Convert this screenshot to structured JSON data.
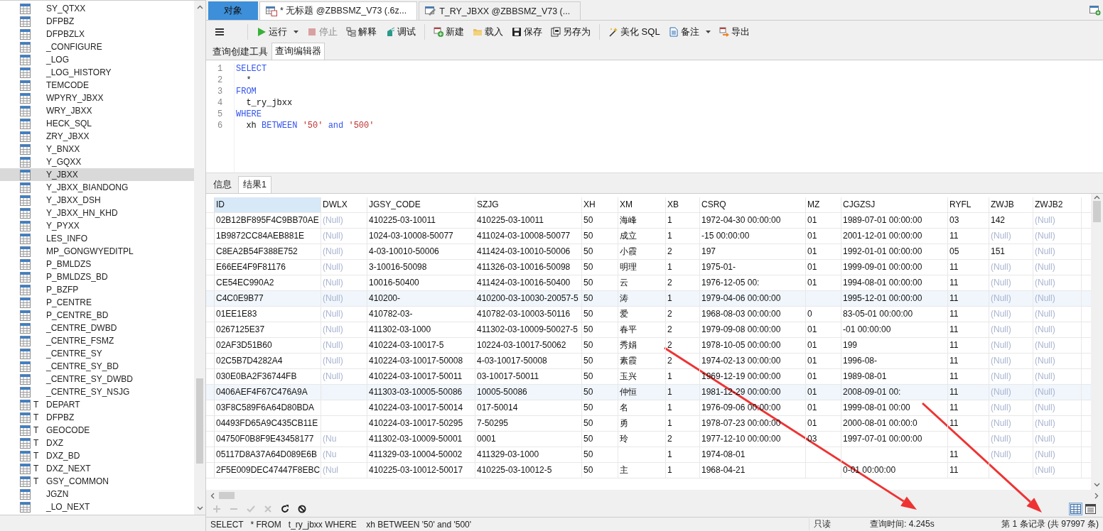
{
  "object_tree": {
    "items": [
      {
        "label": "SY_QTXX",
        "selected": false
      },
      {
        "label": "DFPBZ",
        "selected": false
      },
      {
        "label": "DFPBZLX",
        "selected": false
      },
      {
        "label": "_CONFIGURE",
        "selected": false
      },
      {
        "label": "_LOG",
        "selected": false
      },
      {
        "label": "_LOG_HISTORY",
        "selected": false
      },
      {
        "label": "TEMCODE",
        "selected": false
      },
      {
        "label": "WPYRY_JBXX",
        "selected": false
      },
      {
        "label": "WRY_JBXX",
        "selected": false
      },
      {
        "label": "HECK_SQL",
        "selected": false
      },
      {
        "label": "ZRY_JBXX",
        "selected": false
      },
      {
        "label": "Y_BNXX",
        "selected": false
      },
      {
        "label": "Y_GQXX",
        "selected": false
      },
      {
        "label": "Y_JBXX",
        "selected": true
      },
      {
        "label": "Y_JBXX_BIANDONG",
        "selected": false
      },
      {
        "label": "Y_JBXX_DSH",
        "selected": false
      },
      {
        "label": "Y_JBXX_HN_KHD",
        "selected": false
      },
      {
        "label": "Y_PYXX",
        "selected": false
      },
      {
        "label": "LES_INFO",
        "selected": false
      },
      {
        "label": "MP_GONGWYEDITPL",
        "selected": false
      },
      {
        "label": "P_BMLDZS",
        "selected": false
      },
      {
        "label": "P_BMLDZS_BD",
        "selected": false
      },
      {
        "label": "P_BZFP",
        "selected": false
      },
      {
        "label": "P_CENTRE",
        "selected": false
      },
      {
        "label": "P_CENTRE_BD",
        "selected": false
      },
      {
        "label": "_CENTRE_DWBD",
        "selected": false
      },
      {
        "label": "_CENTRE_FSMZ",
        "selected": false
      },
      {
        "label": "_CENTRE_SY",
        "selected": false
      },
      {
        "label": "_CENTRE_SY_BD",
        "selected": false
      },
      {
        "label": "_CENTRE_SY_DWBD",
        "selected": false
      },
      {
        "label": "_CENTRE_SY_NSJG",
        "selected": false
      },
      {
        "lead": "T",
        "label": "DEPART",
        "selected": false
      },
      {
        "lead": "T",
        "label": "DFPBZ",
        "selected": false
      },
      {
        "lead": "T",
        "label": "GEOCODE",
        "selected": false
      },
      {
        "lead": "T",
        "label": "DXZ",
        "selected": false
      },
      {
        "lead": "T",
        "label": "DXZ_BD",
        "selected": false
      },
      {
        "lead": "T",
        "label": "DXZ_NEXT",
        "selected": false
      },
      {
        "lead": "T",
        "label": "GSY_COMMON",
        "selected": false
      },
      {
        "label": "JGZN",
        "selected": false
      },
      {
        "label": "_LO_NEXT",
        "selected": false
      }
    ]
  },
  "editor_tabs": [
    {
      "kind": "objects",
      "label": "对象",
      "selected": false
    },
    {
      "kind": "query",
      "label": "* 无标题 @ZBBSMZ_V73 (.6z...",
      "selected": true
    },
    {
      "kind": "design",
      "label": "T_RY_JBXX @ZBBSMZ_V73 (...",
      "selected": false
    }
  ],
  "toolbar": [
    [
      {
        "kind": "menu"
      }
    ],
    [
      {
        "kind": "run",
        "label": "运行",
        "dropdown": true,
        "disabled": false
      },
      {
        "kind": "stop",
        "label": "停止",
        "disabled": true
      },
      {
        "kind": "explain",
        "label": "解释",
        "disabled": false
      },
      {
        "kind": "debug",
        "label": "调试",
        "disabled": false
      }
    ],
    [
      {
        "kind": "new",
        "label": "新建",
        "disabled": false
      },
      {
        "kind": "load",
        "label": "载入",
        "disabled": false
      },
      {
        "kind": "save",
        "label": "保存",
        "disabled": false
      },
      {
        "kind": "saveas",
        "label": "另存为",
        "disabled": false
      }
    ],
    [
      {
        "kind": "beautify",
        "label": "美化 SQL",
        "disabled": false
      },
      {
        "kind": "note",
        "label": "备注",
        "dropdown": true,
        "disabled": false
      },
      {
        "kind": "export",
        "label": "导出",
        "disabled": false
      }
    ]
  ],
  "sub_tabs": [
    {
      "label": "查询创建工具",
      "selected": false
    },
    {
      "label": "查询编辑器",
      "selected": true
    }
  ],
  "sql_editor": {
    "lines": [
      {
        "number": "1",
        "tokens": [
          {
            "kind": "keyword",
            "text": "SELECT"
          }
        ]
      },
      {
        "number": "2",
        "tokens": [
          {
            "kind": "plain",
            "text": "  *"
          }
        ]
      },
      {
        "number": "3",
        "tokens": [
          {
            "kind": "keyword",
            "text": "FROM"
          }
        ]
      },
      {
        "number": "4",
        "tokens": [
          {
            "kind": "plain",
            "text": "  t_ry_jbxx"
          }
        ]
      },
      {
        "number": "5",
        "tokens": [
          {
            "kind": "keyword",
            "text": "WHERE"
          }
        ]
      },
      {
        "number": "6",
        "tokens": [
          {
            "kind": "plain",
            "text": "  xh "
          },
          {
            "kind": "keyword",
            "text": "BETWEEN"
          },
          {
            "kind": "string",
            "text": " '50'"
          },
          {
            "kind": "keyword",
            "text": " and"
          },
          {
            "kind": "string",
            "text": " '500'"
          }
        ]
      }
    ]
  },
  "result_tabs": [
    {
      "label": "信息",
      "selected": false
    },
    {
      "label": "结果1",
      "selected": true
    }
  ],
  "table": {
    "columns": [
      "ID",
      "DWLX",
      "JGSY_CODE",
      "SZJG",
      "XH",
      "XM",
      "XB",
      "CSRQ",
      "MZ",
      "CJGZSJ",
      "RYFL",
      "ZWJB",
      "ZWJB2"
    ],
    "rows": [
      {
        "highlighted": false,
        "cells": [
          "02B12BF895F4C9BB70AE",
          {
            "text": "(Null)",
            "null": true
          },
          "410225-03-10011",
          "410225-03-10011",
          "50",
          "海峰",
          "1",
          "1972-04-30 00:00:00",
          "01",
          "1989-07-01 00:00:00",
          "03",
          "142",
          {
            "text": "(Null)",
            "null": true
          }
        ]
      },
      {
        "highlighted": false,
        "cells": [
          "1B9872CC84AEB881E",
          {
            "text": "(Null)",
            "null": true
          },
          "1024-03-10008-50077",
          "411024-03-10008-50077",
          "50",
          "成立",
          "1",
          "-15 00:00:00",
          "01",
          "2001-12-01 00:00:00",
          "11",
          {
            "text": "(Null)",
            "null": true
          },
          {
            "text": "(Null)",
            "null": true
          }
        ]
      },
      {
        "highlighted": false,
        "cells": [
          "C8EA2B54F388E752",
          {
            "text": "(Null)",
            "null": true
          },
          "4-03-10010-50006",
          "411424-03-10010-50006",
          "50",
          "小霞",
          "2",
          "197",
          "01",
          "1992-01-01 00:00:00",
          "05",
          "151",
          {
            "text": "(Null)",
            "null": true
          }
        ]
      },
      {
        "highlighted": false,
        "cells": [
          "E66EE4F9F81176",
          {
            "text": "(Null)",
            "null": true
          },
          "3-10016-50098",
          "411326-03-10016-50098",
          "50",
          "明理",
          "1",
          "1975-01-",
          "01",
          "1999-09-01 00:00:00",
          "11",
          {
            "text": "(Null)",
            "null": true
          },
          {
            "text": "(Null)",
            "null": true
          }
        ]
      },
      {
        "highlighted": false,
        "cells": [
          "CE54EC990A2",
          {
            "text": "(Null)",
            "null": true
          },
          "10016-50400",
          "411424-03-10016-50400",
          "50",
          "云",
          "2",
          "1976-12-05 00:",
          "01",
          "1994-08-01 00:00:00",
          "11",
          {
            "text": "(Null)",
            "null": true
          },
          {
            "text": "(Null)",
            "null": true
          }
        ]
      },
      {
        "highlighted": true,
        "cells": [
          "C4C0E9B77",
          {
            "text": "(Null)",
            "null": true
          },
          "410200-",
          "410200-03-10030-20057-5",
          "50",
          "涛",
          "1",
          "1979-04-06 00:00:00",
          "",
          "1995-12-01 00:00:00",
          "11",
          {
            "text": "(Null)",
            "null": true
          },
          {
            "text": "(Null)",
            "null": true
          }
        ]
      },
      {
        "highlighted": false,
        "cells": [
          "01EE1E83",
          {
            "text": "(Null)",
            "null": true
          },
          "410782-03-",
          "410782-03-10003-50116",
          "50",
          "爱",
          "2",
          "1968-08-03 00:00:00",
          "0",
          "83-05-01 00:00:00",
          "11",
          {
            "text": "(Null)",
            "null": true
          },
          {
            "text": "(Null)",
            "null": true
          }
        ]
      },
      {
        "highlighted": false,
        "cells": [
          "0267125E37",
          {
            "text": "(Null)",
            "null": true
          },
          "411302-03-1000",
          "411302-03-10009-50027-5",
          "50",
          "春平",
          "2",
          "1979-09-08 00:00:00",
          "01",
          "-01 00:00:00",
          "11",
          {
            "text": "(Null)",
            "null": true
          },
          {
            "text": "(Null)",
            "null": true
          }
        ]
      },
      {
        "highlighted": false,
        "cells": [
          "02AF3D51B60",
          {
            "text": "(Null)",
            "null": true
          },
          "410224-03-10017-5",
          "10224-03-10017-50062",
          "50",
          "秀娟",
          "2",
          "1978-10-05 00:00:00",
          "01",
          "199",
          "11",
          {
            "text": "(Null)",
            "null": true
          },
          {
            "text": "(Null)",
            "null": true
          }
        ]
      },
      {
        "highlighted": false,
        "cells": [
          "02C5B7D4282A4",
          {
            "text": "(Null)",
            "null": true
          },
          "410224-03-10017-50008",
          "4-03-10017-50008",
          "50",
          "素霞",
          "2",
          "1974-02-13 00:00:00",
          "01",
          "1996-08-",
          "11",
          {
            "text": "(Null)",
            "null": true
          },
          {
            "text": "(Null)",
            "null": true
          }
        ]
      },
      {
        "highlighted": false,
        "cells": [
          "030E0BA2F36744FB",
          {
            "text": "(Null)",
            "null": true
          },
          "410224-03-10017-50011",
          "03-10017-50011",
          "50",
          "玉兴",
          "1",
          "1969-12-19 00:00:00",
          "01",
          "1989-08-01",
          "11",
          {
            "text": "(Null)",
            "null": true
          },
          {
            "text": "(Null)",
            "null": true
          }
        ]
      },
      {
        "highlighted": true,
        "cells": [
          "0406AEF4F67C476A9A",
          "",
          "411303-03-10005-50086",
          "10005-50086",
          "50",
          "仲恒",
          "1",
          "1981-12-29 00:00:00",
          "01",
          "2008-09-01 00:",
          "11",
          {
            "text": "(Null)",
            "null": true
          },
          {
            "text": "(Null)",
            "null": true
          }
        ]
      },
      {
        "highlighted": false,
        "cells": [
          "03F8C589F6A64D80BDA",
          "",
          "410224-03-10017-50014",
          "017-50014",
          "50",
          "名",
          "1",
          "1976-09-06 00:00:00",
          "01",
          "1999-08-01 00:00",
          "11",
          {
            "text": "(Null)",
            "null": true
          },
          {
            "text": "(Null)",
            "null": true
          }
        ]
      },
      {
        "highlighted": false,
        "cells": [
          "04493FD65A9C435CB11E",
          "",
          "410224-03-10017-50295",
          "7-50295",
          "50",
          "勇",
          "1",
          "1978-07-23 00:00:00",
          "01",
          "2000-08-01 00:00:0",
          "11",
          {
            "text": "(Null)",
            "null": true
          },
          {
            "text": "(Null)",
            "null": true
          }
        ]
      },
      {
        "highlighted": false,
        "cells": [
          "04750F0B8F9E43458177",
          {
            "text": "(Nu",
            "null": true
          },
          "411302-03-10009-50001",
          "0001",
          "50",
          "玲",
          "2",
          "1977-12-10 00:00:00",
          "03",
          "1997-07-01 00:00:00",
          "",
          {
            "text": "(Null)",
            "null": true
          },
          {
            "text": "(Null)",
            "null": true
          }
        ]
      },
      {
        "highlighted": false,
        "cells": [
          "05117D8A37A64D089E6B",
          {
            "text": "(Nu",
            "null": true
          },
          "411329-03-10004-50002",
          "411329-03-1000",
          "50",
          "",
          "1",
          "1974-08-01",
          "",
          "",
          "11",
          {
            "text": "(Null)",
            "null": true
          },
          {
            "text": "(Null)",
            "null": true
          }
        ]
      },
      {
        "highlighted": false,
        "cells": [
          "2F5E009DEC47447F8EBC",
          {
            "text": "(Nul",
            "null": true
          },
          "410225-03-10012-50017",
          "410225-03-10012-5",
          "50",
          "主",
          "1",
          "1968-04-21",
          "",
          "0-01 00:00:00",
          "11",
          "",
          {
            "text": "(Null)",
            "null": true
          }
        ]
      }
    ]
  },
  "grid_toolbar": [
    {
      "kind": "add",
      "disabled": true
    },
    {
      "kind": "remove",
      "disabled": true
    },
    {
      "kind": "apply",
      "disabled": true
    },
    {
      "kind": "discard",
      "disabled": true
    },
    {
      "kind": "refresh",
      "disabled": false
    },
    {
      "kind": "stop",
      "disabled": false
    }
  ],
  "view_toggles": [
    {
      "kind": "grid",
      "selected": true
    },
    {
      "kind": "form",
      "selected": false
    }
  ],
  "status_bar": {
    "sql": "SELECT   * FROM   t_ry_jbxx WHERE    xh BETWEEN '50' and '500'",
    "mode": "只读",
    "query_time": "查询时间: 4.245s",
    "record": "第 1 条记录 (共 97997 条)"
  },
  "annotations": [
    {
      "kind": "arrow",
      "color": "#ee3333"
    },
    {
      "kind": "arrow",
      "color": "#ee3333"
    }
  ]
}
